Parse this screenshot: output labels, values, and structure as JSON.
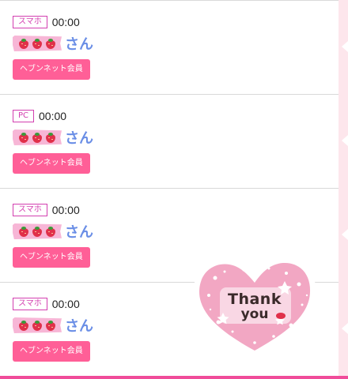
{
  "rows": [
    {
      "device": "スマホ",
      "time": "00:00",
      "suffix": "さん",
      "button": "ヘブンネット会員"
    },
    {
      "device": "PC",
      "time": "00:00",
      "suffix": "さん",
      "button": "ヘブンネット会員"
    },
    {
      "device": "スマホ",
      "time": "00:00",
      "suffix": "さん",
      "button": "ヘブンネット会員"
    },
    {
      "device": "スマホ",
      "time": "00:00",
      "suffix": "さん",
      "button": "ヘブンネット会員"
    }
  ],
  "sticker": {
    "line1": "Thank",
    "line2": "you"
  },
  "icons": {
    "name_decoration": "strawberry-icon",
    "sticker": "heart-thank-you-sticker"
  },
  "colors": {
    "badge": "#d33fb0",
    "button": "#ff5f97",
    "tape": "#f7b6d6",
    "name_suffix": "#6a8ee6",
    "bottom_bar": "#f04c9a",
    "side_strip": "#fde6ec"
  }
}
